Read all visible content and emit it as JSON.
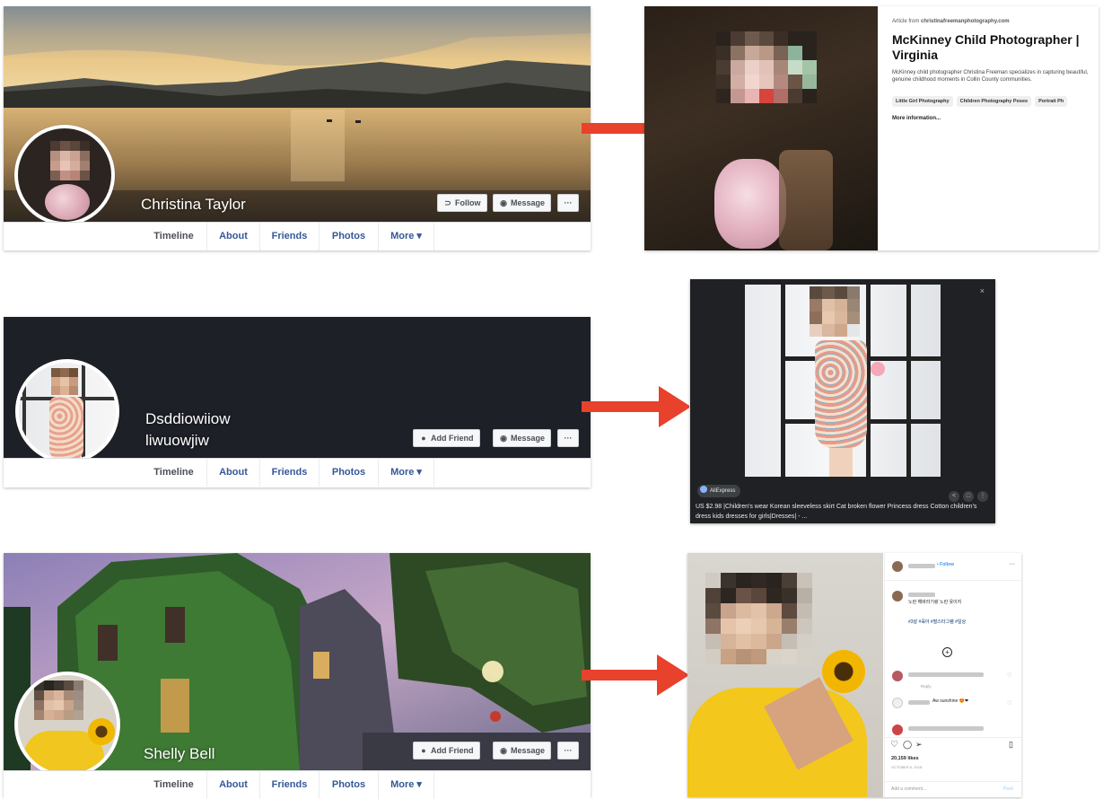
{
  "profiles": [
    {
      "name": "Christina Taylor",
      "buttons": [
        {
          "icon": "rss-icon",
          "glyph": "⊃",
          "label": "Follow"
        },
        {
          "icon": "messenger-icon",
          "glyph": "◉",
          "label": "Message"
        },
        {
          "icon": "more-icon",
          "glyph": "···",
          "label": ""
        }
      ],
      "tabs": [
        "Timeline",
        "About",
        "Friends",
        "Photos",
        "More ▾"
      ]
    },
    {
      "name_line1": "Dsddiowiiow",
      "name_line2": "liwuowjiw",
      "buttons": [
        {
          "icon": "add-friend-icon",
          "glyph": "👤",
          "label": "Add Friend"
        },
        {
          "icon": "messenger-icon",
          "glyph": "◉",
          "label": "Message"
        },
        {
          "icon": "more-icon",
          "glyph": "···",
          "label": ""
        }
      ],
      "tabs": [
        "Timeline",
        "About",
        "Friends",
        "Photos",
        "More ▾"
      ]
    },
    {
      "name": "Shelly Bell",
      "buttons": [
        {
          "icon": "add-friend-icon",
          "glyph": "👤",
          "label": "Add Friend"
        },
        {
          "icon": "messenger-icon",
          "glyph": "◉",
          "label": "Message"
        },
        {
          "icon": "more-icon",
          "glyph": "···",
          "label": ""
        }
      ],
      "tabs": [
        "Timeline",
        "About",
        "Friends",
        "Photos",
        "More ▾"
      ]
    }
  ],
  "pinterest": {
    "from_prefix": "Article from ",
    "from_site": "christinafreemanphotography.com",
    "title": "McKinney Child Photographer | Virginia",
    "description": "McKinney child photographer Christina Freeman specializes in capturing beautiful, genuine childhood moments in Collin County communities.",
    "tags": [
      "Little Girl Photography",
      "Children Photography Poses",
      "Portrait Ph"
    ],
    "more": "More information..."
  },
  "lens": {
    "close": "×",
    "source": "AliExpress",
    "caption": "US $2.98 |Children's wear Korean sleeveless skirt Cat broken flower Princess dress Cotton children's dress kids dresses for girls|Dresses| - ...",
    "icons": [
      "share-icon",
      "bookmark-icon",
      "more-vert-icon"
    ]
  },
  "instagram": {
    "follow": "• Follow",
    "more": "···",
    "caption_line": "노란 해바라기랑 노란 옷이지",
    "hashtags": "#3살 #육아 #딸스타그램 #일상",
    "comment_fragment_1": "Aw sunshine 😍❤",
    "likes": "20,159 likes",
    "date": "OCTOBER 6, 2018",
    "reply": "Reply",
    "add_comment": "Add a comment...",
    "post": "Post"
  },
  "colors": {
    "fb_link": "#365899",
    "arrow": "#e8412c",
    "dark_cover": "#1d2027",
    "lens_bg": "#202124"
  }
}
